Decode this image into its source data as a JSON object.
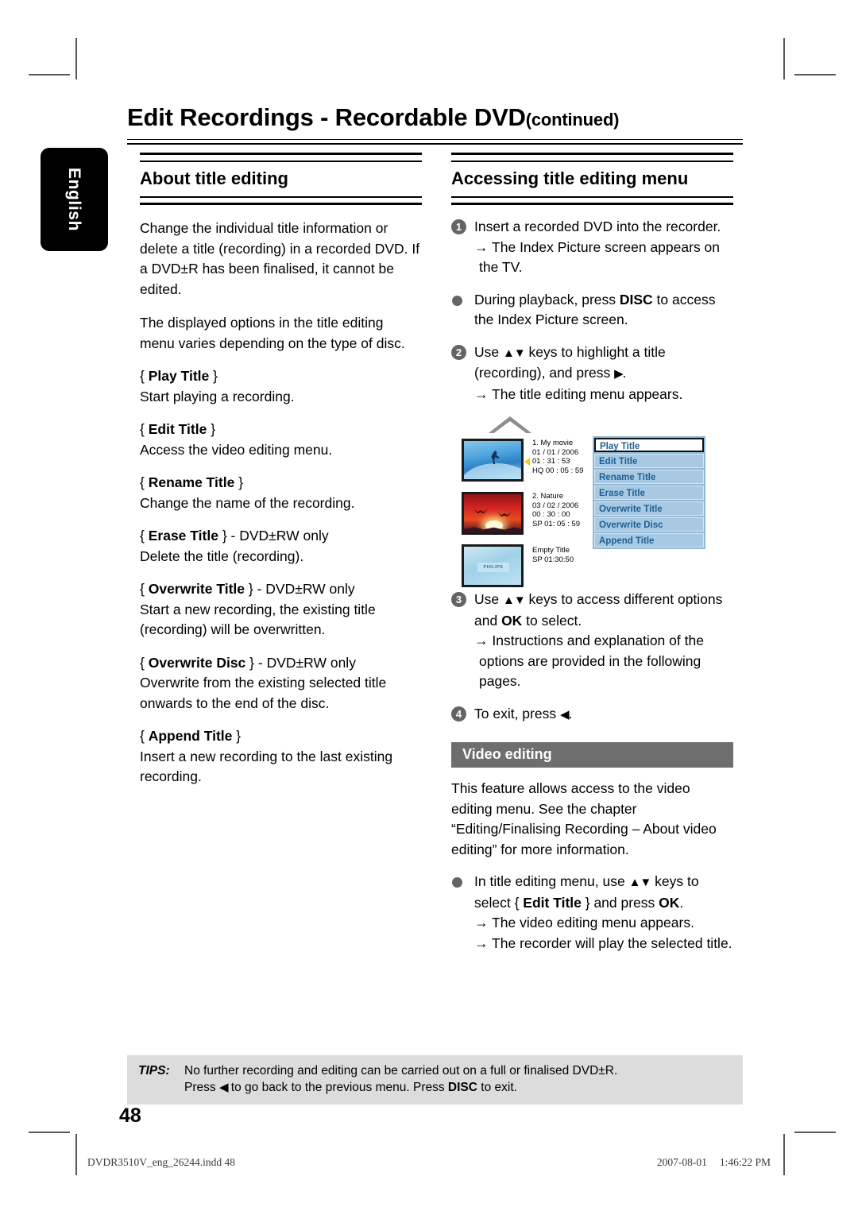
{
  "language_tab": "English",
  "page_title": {
    "main": "Edit Recordings - Recordable DVD",
    "continued": "(continued)"
  },
  "left_column": {
    "heading": "About title editing",
    "intro_paragraph_1": "Change the individual title information or delete a title (recording) in a recorded DVD. If a DVD±R has been finalised, it cannot be edited.",
    "intro_paragraph_2": "The displayed options in the title editing menu varies depending on the type of disc.",
    "options": [
      {
        "open": "{",
        "name": "Play Title",
        "close": "}",
        "suffix": "",
        "desc": "Start playing a recording."
      },
      {
        "open": "{",
        "name": "Edit Title",
        "close": "}",
        "suffix": "",
        "desc": "Access the video editing menu."
      },
      {
        "open": "{",
        "name": "Rename Title",
        "close": "}",
        "suffix": "",
        "desc": "Change the name of the recording."
      },
      {
        "open": "{",
        "name": "Erase Title",
        "close": "}",
        "suffix": " - DVD±RW only",
        "desc": "Delete the title (recording)."
      },
      {
        "open": "{",
        "name": "Overwrite Title",
        "close": "}",
        "suffix": " - DVD±RW only",
        "desc": "Start a new recording, the existing title (recording) will be overwritten."
      },
      {
        "open": "{",
        "name": "Overwrite Disc",
        "close": "}",
        "suffix": " - DVD±RW only",
        "desc": "Overwrite from the existing selected title onwards to the end of the disc."
      },
      {
        "open": "{",
        "name": "Append Title",
        "close": "}",
        "suffix": "",
        "desc": "Insert a new recording to the last existing recording."
      }
    ]
  },
  "right_column": {
    "heading": "Accessing title editing menu",
    "step1": {
      "num": "1",
      "text": "Insert a recorded DVD into the recorder.",
      "result": "→ The Index Picture screen appears on the TV."
    },
    "bullet1": {
      "pre": "During playback, press ",
      "key": "DISC",
      "post": " to access the Index Picture screen."
    },
    "step2": {
      "num": "2",
      "pre": "Use ",
      "updown": "▲▼",
      "mid": " keys to highlight a title (recording), and press ",
      "right": "▶",
      "post": ".",
      "result": "→  The title editing menu appears."
    },
    "step3": {
      "num": "3",
      "pre": "Use ",
      "updown": "▲▼",
      "mid": " keys to access different options and ",
      "key": "OK",
      "post": " to select.",
      "result": "→  Instructions and explanation of the options are provided in the following pages."
    },
    "step4": {
      "num": "4",
      "pre": "To exit, press ",
      "left": "◀",
      "post": "."
    },
    "video_editing": {
      "bar_title": "Video editing",
      "paragraph": "This feature allows access to the video editing menu. See the chapter “Editing/Finalising Recording – About video editing” for more information.",
      "bullet": {
        "pre": "In title editing menu, use ",
        "updown": "▲▼",
        "mid": " keys to select { ",
        "option": "Edit Title",
        "mid2": " } and press ",
        "key": "OK",
        "post": ".",
        "result1": "→ The video editing menu appears.",
        "result2": "→ The recorder will play the selected title."
      }
    }
  },
  "illustration": {
    "titles": [
      {
        "line1": "1. My movie",
        "line2": "01 / 01 / 2006",
        "line3": "01 : 31 : 53",
        "line4": "HQ  00 : 05 : 59"
      },
      {
        "line1": "2. Nature",
        "line2": "03 / 02 / 2006",
        "line3": "00 : 30 : 00",
        "line4": "SP  01: 05 : 59"
      },
      {
        "line1": "Empty Title",
        "line2": "SP 01:30:50",
        "line3": "",
        "line4": ""
      }
    ],
    "thumb3_logo": "PHILIPS",
    "menu_items": [
      {
        "label": "Play Title",
        "selected": true
      },
      {
        "label": "Edit Title",
        "selected": false
      },
      {
        "label": "Rename Title",
        "selected": false
      },
      {
        "label": "Erase Title",
        "selected": false
      },
      {
        "label": "Overwrite Title",
        "selected": false
      },
      {
        "label": "Overwrite Disc",
        "selected": false
      },
      {
        "label": "Append Title",
        "selected": false
      }
    ]
  },
  "tips": {
    "label": "TIPS:",
    "line1": "No further recording and editing can be carried out on a full or finalised DVD±R.",
    "line2_pre": "Press ",
    "line2_left": "◀",
    "line2_mid": " to go back to the previous menu. Press ",
    "line2_key": "DISC",
    "line2_post": " to exit."
  },
  "page_number": "48",
  "print_footer": {
    "filename": "DVDR3510V_eng_26244.indd   48",
    "date": "2007-08-01",
    "time": "1:46:22 PM"
  }
}
